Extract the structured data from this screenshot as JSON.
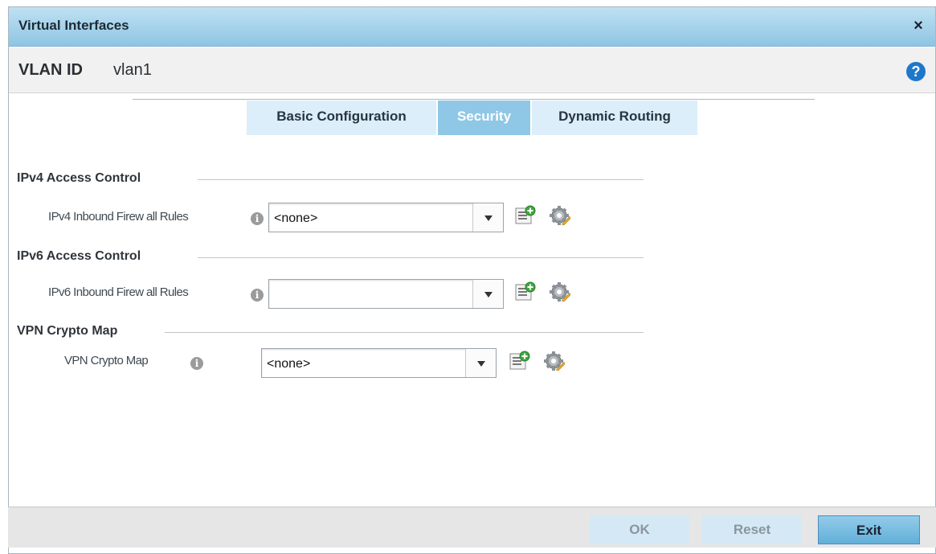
{
  "dialog": {
    "title": "Virtual Interfaces",
    "close_label": "×"
  },
  "header": {
    "vlan_label": "VLAN ID",
    "vlan_value": "vlan1",
    "help_label": "?"
  },
  "tabs": [
    {
      "label": "Basic Configuration",
      "active": false
    },
    {
      "label": "Security",
      "active": true
    },
    {
      "label": "Dynamic Routing",
      "active": false
    }
  ],
  "sections": {
    "ipv4": {
      "title": "IPv4 Access Control",
      "field_label": "IPv4 Inbound Firew all Rules",
      "value": "<none>"
    },
    "ipv6": {
      "title": "IPv6 Access Control",
      "field_label": "IPv6 Inbound Firew all Rules",
      "value": ""
    },
    "vpn": {
      "title": "VPN Crypto Map",
      "field_label": "VPN Crypto Map",
      "value": "<none>"
    }
  },
  "footer": {
    "ok_label": "OK",
    "reset_label": "Reset",
    "exit_label": "Exit"
  },
  "colors": {
    "accent": "#8fc8e6",
    "title_bar": "#a5d2ea",
    "button_primary": "#62afd9"
  }
}
